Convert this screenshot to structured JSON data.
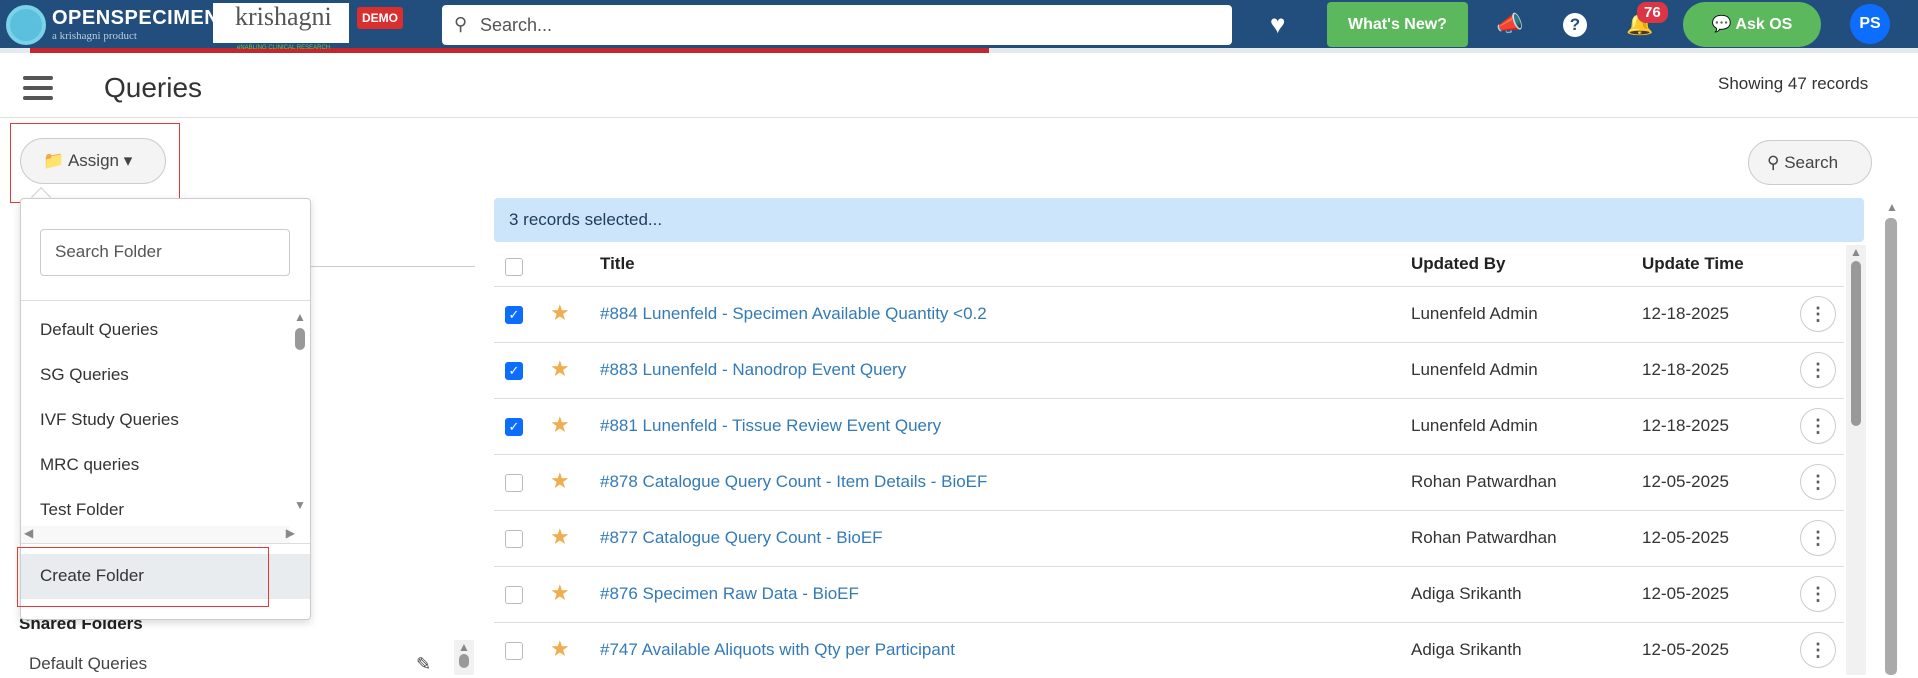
{
  "header": {
    "brand": "OPENSPECIMEN",
    "brand_sub": "a krishagni product",
    "partner": "krishagni",
    "partner_sub": "eNABLING CLINICAL RESEARCH",
    "demo": "DEMO",
    "search_placeholder": "Search...",
    "whats_new": "What's New?",
    "notifications": "76",
    "ask_os": "Ask OS",
    "avatar": "PS",
    "progress": 0.5
  },
  "page": {
    "title": "Queries",
    "showing": "Showing 47 records"
  },
  "toolbar": {
    "assign": "Assign",
    "search": "Search"
  },
  "folder_dropdown": {
    "search_placeholder": "Search Folder",
    "items": [
      "Default Queries",
      "SG Queries",
      "IVF Study Queries",
      "MRC queries",
      "Test Folder"
    ],
    "create": "Create Folder"
  },
  "sidebar": {
    "shared_heading": "Shared Folders",
    "shared_items": [
      "Default Queries"
    ]
  },
  "table": {
    "selection": "3 records selected...",
    "columns": [
      "Title",
      "Updated By",
      "Update Time"
    ],
    "rows": [
      {
        "checked": true,
        "title": "#884 Lunenfeld - Specimen Available Quantity <0.2",
        "by": "Lunenfeld Admin",
        "time": "12-18-2025"
      },
      {
        "checked": true,
        "title": "#883 Lunenfeld - Nanodrop Event Query",
        "by": "Lunenfeld Admin",
        "time": "12-18-2025"
      },
      {
        "checked": true,
        "title": "#881 Lunenfeld - Tissue Review Event Query",
        "by": "Lunenfeld Admin",
        "time": "12-18-2025"
      },
      {
        "checked": false,
        "title": "#878 Catalogue Query Count - Item Details - BioEF",
        "by": "Rohan Patwardhan",
        "time": "12-05-2025"
      },
      {
        "checked": false,
        "title": "#877 Catalogue Query Count - BioEF",
        "by": "Rohan Patwardhan",
        "time": "12-05-2025"
      },
      {
        "checked": false,
        "title": "#876 Specimen Raw Data - BioEF",
        "by": "Adiga Srikanth",
        "time": "12-05-2025"
      },
      {
        "checked": false,
        "title": "#747 Available Aliquots with Qty per Participant",
        "by": "Adiga Srikanth",
        "time": "12-05-2025"
      }
    ]
  },
  "colors": {
    "header": "#224e7e",
    "accent_green": "#5cb85c",
    "link": "#337ab7",
    "star": "#f0ad4e",
    "selection_bar": "#cce5fb",
    "badge": "#dc3545"
  }
}
